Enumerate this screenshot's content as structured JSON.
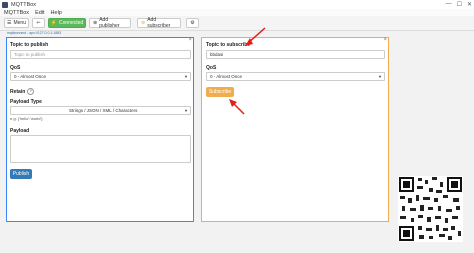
{
  "window": {
    "title": "MQTTBox",
    "icon": "app-icon",
    "controls": [
      "—",
      "☐",
      "✕"
    ]
  },
  "menu": {
    "items": [
      "MQTTBox",
      "Edit",
      "Help"
    ]
  },
  "toolbar": {
    "menu_label": "Menu",
    "back_icon": "arrow-left-icon",
    "connected_label": "Connected",
    "add_publisher_label": "Add publisher",
    "add_subscriber_label": "Add subscriber",
    "settings_icon": "gear-icon"
  },
  "breadcrumb": "mqttconnect - apv://127.0.0.1:1883",
  "publisher": {
    "topic_label": "Topic to publish",
    "topic_placeholder": "Topic to publish",
    "qos_label": "QoS",
    "qos_value": "0 - Almost Once",
    "retain_label": "Retain",
    "payload_type_label": "Payload Type",
    "payload_type_value": "Strings / JSON / XML / Characters",
    "payload_hint": "e.g: {'hello':'world'}",
    "payload_label": "Payload",
    "publish_label": "Publish"
  },
  "subscriber": {
    "topic_label": "Topic to subscribe",
    "topic_value": "bbdasi",
    "qos_label": "QoS",
    "qos_value": "0 - Almost Once",
    "subscribe_label": "Subscribe"
  },
  "colors": {
    "publisher_border": "#3a86ff",
    "subscriber_border": "#f0ad4e",
    "connected": "#5cb85c",
    "primary": "#337ab7",
    "arrow": "#e0201b"
  }
}
